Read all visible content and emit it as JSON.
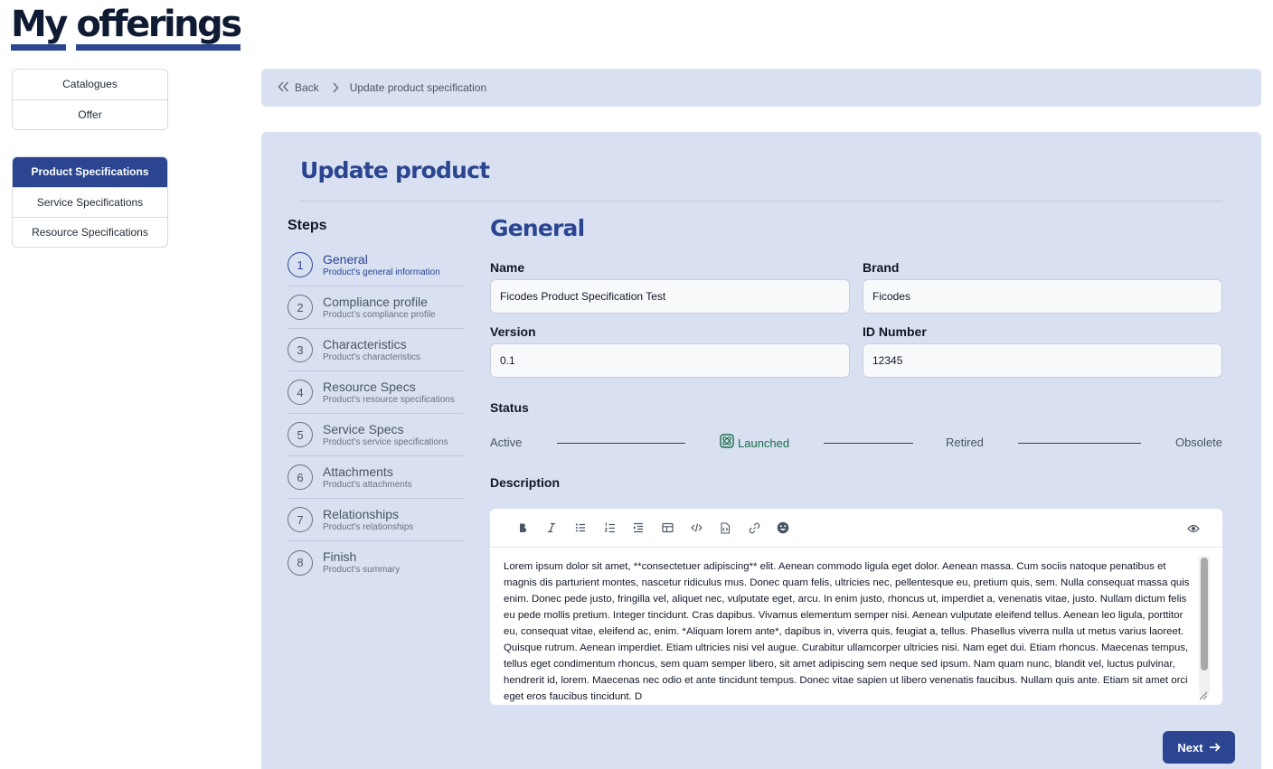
{
  "header": {
    "title_words": [
      "My",
      "offerings"
    ]
  },
  "sidebar": {
    "group1": [
      {
        "label": "Catalogues"
      },
      {
        "label": "Offer"
      }
    ],
    "group2": [
      {
        "label": "Product Specifications",
        "active": true
      },
      {
        "label": "Service Specifications"
      },
      {
        "label": "Resource Specifications"
      }
    ]
  },
  "breadcrumb": {
    "back_label": "Back",
    "current": "Update product specification"
  },
  "form": {
    "title": "Update product",
    "steps_title": "Steps",
    "steps": [
      {
        "number": "1",
        "label": "General",
        "sub": "Product's general information",
        "active": true
      },
      {
        "number": "2",
        "label": "Compliance profile",
        "sub": "Product's compliance profile"
      },
      {
        "number": "3",
        "label": "Characteristics",
        "sub": "Product's characteristics"
      },
      {
        "number": "4",
        "label": "Resource Specs",
        "sub": "Product's resource specifications"
      },
      {
        "number": "5",
        "label": "Service Specs",
        "sub": "Product's service specifications"
      },
      {
        "number": "6",
        "label": "Attachments",
        "sub": "Product's attachments"
      },
      {
        "number": "7",
        "label": "Relationships",
        "sub": "Product's relationships"
      },
      {
        "number": "8",
        "label": "Finish",
        "sub": "Product's summary"
      }
    ],
    "section_title": "General",
    "fields": {
      "name": {
        "label": "Name",
        "value": "Ficodes Product Specification Test"
      },
      "brand": {
        "label": "Brand",
        "value": "Ficodes"
      },
      "version": {
        "label": "Version",
        "value": "0.1"
      },
      "id_number": {
        "label": "ID Number",
        "value": "12345"
      }
    },
    "status": {
      "label": "Status",
      "options": [
        "Active",
        "Launched",
        "Retired",
        "Obsolete"
      ],
      "current": "Launched",
      "current_color": "#1b6e4a"
    },
    "description": {
      "label": "Description",
      "toolbar": [
        "bold-icon",
        "italic-icon",
        "bullet-list-icon",
        "numbered-list-icon",
        "indent-icon",
        "table-icon",
        "code-icon",
        "code-block-icon",
        "link-icon",
        "emoji-icon"
      ],
      "preview_icon": "eye-icon",
      "text": "Lorem ipsum dolor sit amet, **consectetuer adipiscing** elit. Aenean commodo ligula eget dolor. Aenean massa. Cum sociis natoque penatibus et magnis dis parturient montes, nascetur ridiculus mus. Donec quam felis, ultricies nec, pellentesque eu, pretium quis, sem. Nulla consequat massa quis enim. Donec pede justo, fringilla vel, aliquet nec, vulputate eget, arcu. In enim justo, rhoncus ut, imperdiet a, venenatis vitae, justo. Nullam dictum felis eu pede mollis pretium. Integer tincidunt. Cras dapibus. Vivamus elementum semper nisi. Aenean vulputate eleifend tellus. Aenean leo ligula, porttitor eu, consequat vitae, eleifend ac, enim. *Aliquam lorem ante*, dapibus in, viverra quis, feugiat a, tellus. Phasellus viverra nulla ut metus varius laoreet. Quisque rutrum. Aenean imperdiet. Etiam ultricies nisi vel augue. Curabitur ullamcorper ultricies nisi. Nam eget dui. Etiam rhoncus. Maecenas tempus, tellus eget condimentum rhoncus, sem quam semper libero, sit amet adipiscing sem neque sed ipsum. Nam quam nunc, blandit vel, luctus pulvinar, hendrerit id, lorem. Maecenas nec odio et ante tincidunt tempus. Donec vitae sapien ut libero venenatis faucibus. Nullam quis ante. Etiam sit amet orci eget eros faucibus tincidunt. D"
    },
    "next_label": "Next"
  },
  "colors": {
    "primary": "#2b4590",
    "panel": "#d8e0f2",
    "success": "#1b6e4a"
  }
}
